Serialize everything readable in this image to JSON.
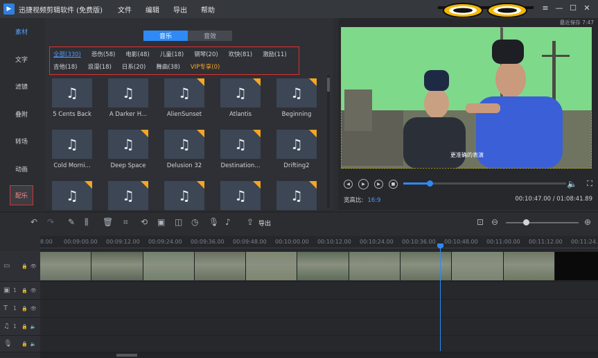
{
  "app": {
    "title": "迅捷视频剪辑软件 (免费版)",
    "menu": [
      "文件",
      "编辑",
      "导出",
      "帮助"
    ],
    "window_buttons": [
      "≡",
      "—",
      "☐",
      "✕"
    ]
  },
  "sidebar": {
    "items": [
      {
        "label": "素材",
        "state": "active"
      },
      {
        "label": "文字",
        "state": ""
      },
      {
        "label": "滤镜",
        "state": ""
      },
      {
        "label": "叠附",
        "state": ""
      },
      {
        "label": "转场",
        "state": ""
      },
      {
        "label": "动画",
        "state": ""
      },
      {
        "label": "配乐",
        "state": "current"
      }
    ]
  },
  "library": {
    "tabs": [
      {
        "label": "音乐",
        "active": true
      },
      {
        "label": "音效",
        "active": false
      }
    ],
    "filters_row1": [
      {
        "label": "全部(330)",
        "selected": true
      },
      {
        "label": "悲伤(58)"
      },
      {
        "label": "电影(48)"
      },
      {
        "label": "儿童(18)"
      },
      {
        "label": "钢琴(20)"
      },
      {
        "label": "欢快(81)"
      },
      {
        "label": "激励(11)"
      }
    ],
    "filters_row2": [
      {
        "label": "吉他(18)"
      },
      {
        "label": "浪漫(18)"
      },
      {
        "label": "日系(20)"
      },
      {
        "label": "舞曲(38)"
      },
      {
        "label": "VIP专享(0)",
        "vip": true
      }
    ],
    "tracks": [
      {
        "name": "5 Cents Back",
        "vip": false
      },
      {
        "name": "A Darker H...",
        "vip": false
      },
      {
        "name": "AlienSunset",
        "vip": true
      },
      {
        "name": "Atlantis",
        "vip": true
      },
      {
        "name": "Beginning",
        "vip": true
      },
      {
        "name": "Cold Morni...",
        "vip": false
      },
      {
        "name": "Deep Space",
        "vip": true
      },
      {
        "name": "Delusion 32",
        "vip": true
      },
      {
        "name": "Destination...",
        "vip": true
      },
      {
        "name": "Drifting2",
        "vip": true
      },
      {
        "name": "",
        "vip": true
      },
      {
        "name": "",
        "vip": true
      },
      {
        "name": "",
        "vip": true
      },
      {
        "name": "",
        "vip": true
      },
      {
        "name": "",
        "vip": true
      }
    ],
    "note_icon": "♫"
  },
  "preview": {
    "autosave": "最近保存 7:47",
    "subtitle": "更准确的表演",
    "aspect_label": "宽高比:",
    "aspect_value": "16:9",
    "timecode": "00:10:47.00 / 01:08:41.89",
    "progress": 0.16
  },
  "toolbar": {
    "export_label": "导出"
  },
  "timeline": {
    "ticks": [
      "8.00",
      "00:09:00.00",
      "00:09:12.00",
      "00:09:24.00",
      "00:09:36.00",
      "00:09:48.00",
      "00:10:00.00",
      "00:10:12.00",
      "00:10:24.00",
      "00:10:36.00",
      "00:10:48.00",
      "00:11:00.00",
      "00:11:12.00",
      "00:11:24.00"
    ],
    "track_numbers": [
      "1",
      "1",
      "1",
      "1"
    ]
  }
}
